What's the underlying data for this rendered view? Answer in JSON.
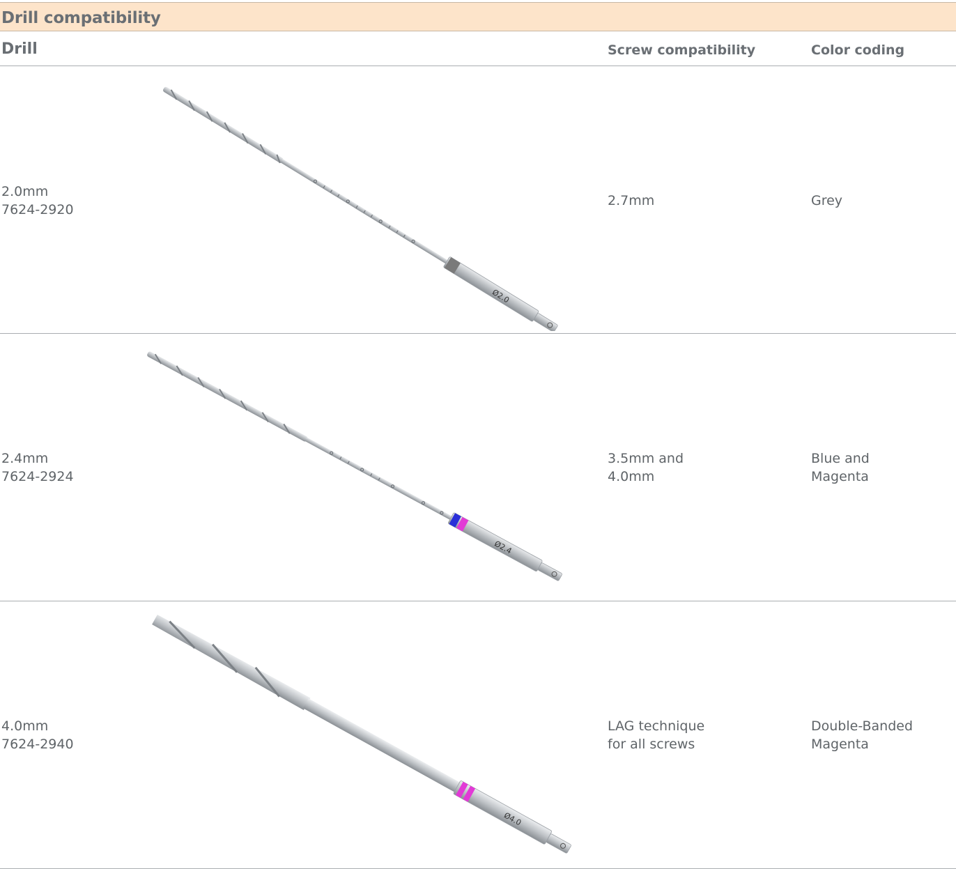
{
  "section_title": "Drill compatibility",
  "columns": {
    "drill": "Drill",
    "screw": "Screw compatibility",
    "color": "Color coding"
  },
  "rows": [
    {
      "size": "2.0mm",
      "part": "7624-2920",
      "drill_text": "2.0mm\n7624-2920",
      "screw": "2.7mm",
      "color": "Grey",
      "marking": "Ø2.0",
      "band_colors": [
        "#7a7a7a"
      ]
    },
    {
      "size": "2.4mm",
      "part": "7624-2924",
      "drill_text": "2.4mm\n7624-2924",
      "screw": "3.5mm and\n4.0mm",
      "color": "Blue and\nMagenta",
      "marking": "Ø2.4",
      "band_colors": [
        "#2a2fd8",
        "#e23ad6"
      ]
    },
    {
      "size": "4.0mm",
      "part": "7624-2940",
      "drill_text": "4.0mm\n7624-2940",
      "screw": "LAG technique\nfor all screws",
      "color": "Double-Banded\nMagenta",
      "marking": "Ø4.0",
      "band_colors": [
        "#e23ad6",
        "#e23ad6"
      ]
    }
  ]
}
